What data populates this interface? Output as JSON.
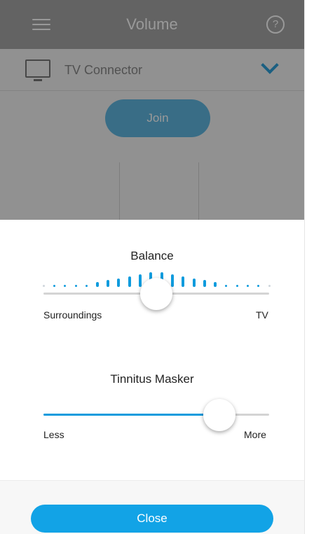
{
  "app_bar": {
    "title": "Volume",
    "help_label": "?"
  },
  "device": {
    "name": "TV Connector"
  },
  "join_label": "Join",
  "balance": {
    "title": "Balance",
    "left_label": "Surroundings",
    "right_label": "TV",
    "value": 0.5
  },
  "tinnitus": {
    "title": "Tinnitus Masker",
    "left_label": "Less",
    "right_label": "More",
    "value": 0.78
  },
  "close_label": "Close",
  "colors": {
    "accent": "#12a3e6",
    "track": "#d4d4d4",
    "dot_inactive": "#cfd6dc"
  }
}
